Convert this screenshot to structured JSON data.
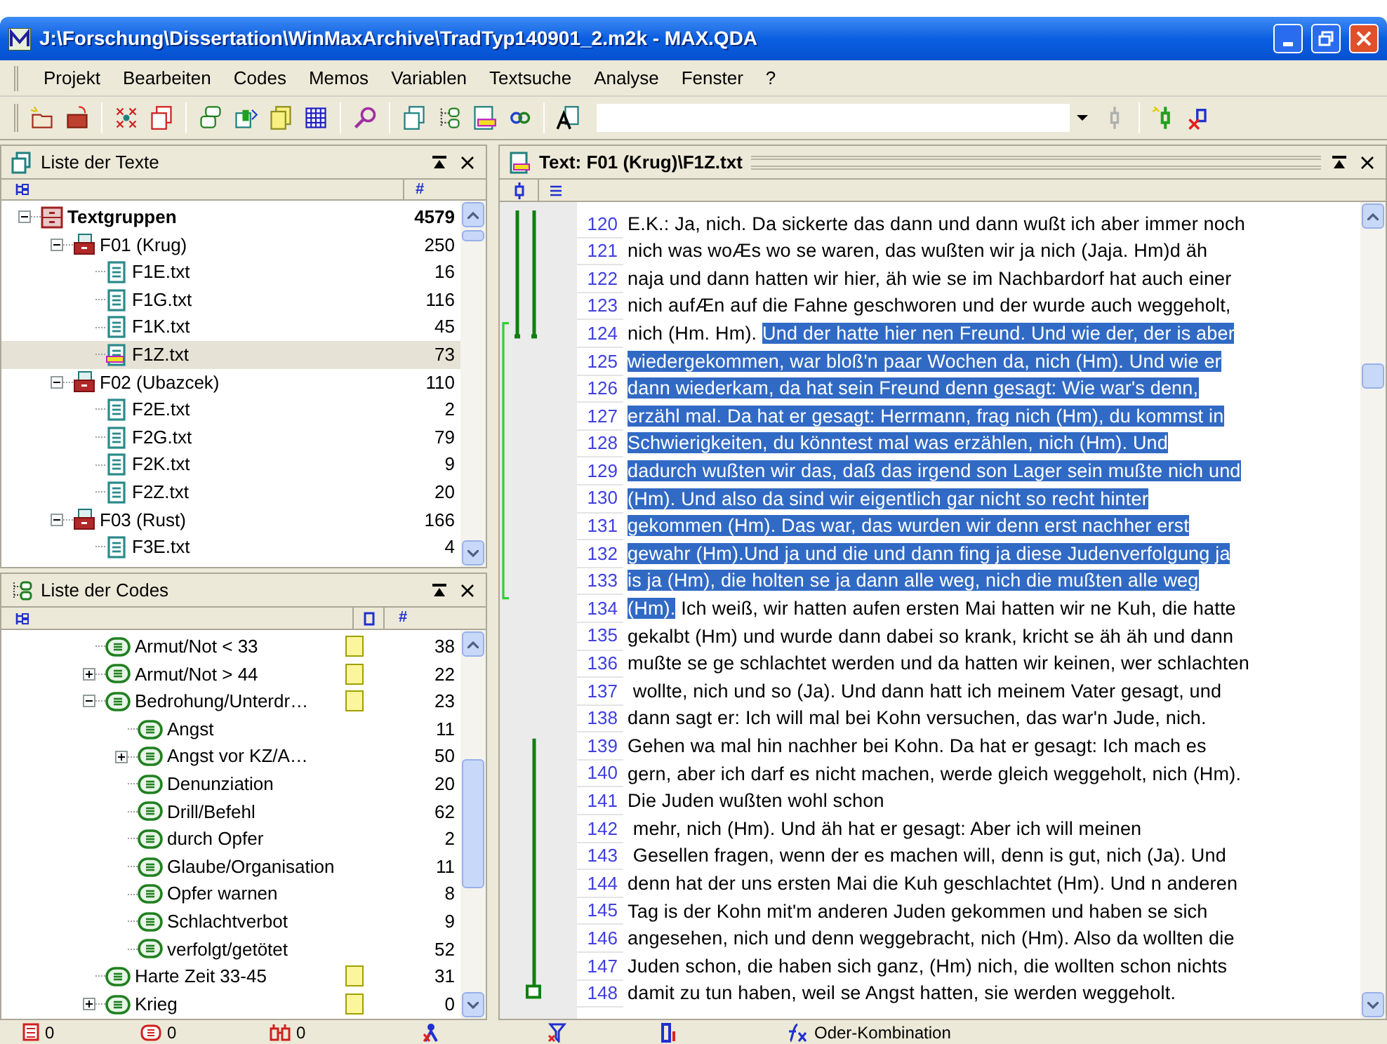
{
  "window": {
    "title": "J:\\Forschung\\Dissertation\\WinMaxArchive\\TradTyp140901_2.m2k - MAX.QDA"
  },
  "menu": [
    "Projekt",
    "Bearbeiten",
    "Codes",
    "Memos",
    "Variablen",
    "Textsuche",
    "Analyse",
    "Fenster",
    "?"
  ],
  "text_list": {
    "title": "Liste der Texte",
    "count_header": "#",
    "tree": [
      {
        "label": "Textgruppen",
        "count": "4579",
        "kind": "group",
        "expanded": true,
        "selected": false,
        "children": [
          {
            "label": "F01 (Krug)",
            "count": "250",
            "kind": "folder",
            "expanded": true,
            "selected": false,
            "children": [
              {
                "label": "F1E.txt",
                "count": "16",
                "kind": "file",
                "selected": false
              },
              {
                "label": "F1G.txt",
                "count": "116",
                "kind": "file",
                "selected": false
              },
              {
                "label": "F1K.txt",
                "count": "45",
                "kind": "file",
                "selected": false
              },
              {
                "label": "F1Z.txt",
                "count": "73",
                "kind": "file",
                "selected": true
              }
            ]
          },
          {
            "label": "F02 (Ubazcek)",
            "count": "110",
            "kind": "folder",
            "expanded": true,
            "selected": false,
            "children": [
              {
                "label": "F2E.txt",
                "count": "2",
                "kind": "file",
                "selected": false
              },
              {
                "label": "F2G.txt",
                "count": "79",
                "kind": "file",
                "selected": false
              },
              {
                "label": "F2K.txt",
                "count": "9",
                "kind": "file",
                "selected": false
              },
              {
                "label": "F2Z.txt",
                "count": "20",
                "kind": "file",
                "selected": false
              }
            ]
          },
          {
            "label": "F03 (Rust)",
            "count": "166",
            "kind": "folder",
            "expanded": true,
            "selected": false,
            "children": [
              {
                "label": "F3E.txt",
                "count": "4",
                "kind": "file",
                "selected": false
              }
            ]
          }
        ]
      }
    ]
  },
  "code_list": {
    "title": "Liste der Codes",
    "count_header": "#",
    "tree": [
      {
        "label": "Armut/Not < 33",
        "count": "38",
        "color": "#fbf59b"
      },
      {
        "label": "Armut/Not > 44",
        "count": "22",
        "color": "#fbf59b",
        "expanded": false
      },
      {
        "label": "Bedrohung/Unterdr…",
        "count": "23",
        "color": "#fbf59b",
        "expanded": true,
        "children": [
          {
            "label": "Angst",
            "count": "11"
          },
          {
            "label": "Angst vor KZ/A…",
            "count": "50",
            "expanded": false
          },
          {
            "label": "Denunziation",
            "count": "20"
          },
          {
            "label": "Drill/Befehl",
            "count": "62"
          },
          {
            "label": "durch Opfer",
            "count": "2"
          },
          {
            "label": "Glaube/Organisation",
            "count": "11"
          },
          {
            "label": "Opfer warnen",
            "count": "8"
          },
          {
            "label": "Schlachtverbot",
            "count": "9"
          },
          {
            "label": "verfolgt/getötet",
            "count": "52"
          }
        ]
      },
      {
        "label": "Harte Zeit 33-45",
        "count": "31",
        "color": "#fbf59b"
      },
      {
        "label": "Krieg",
        "count": "0",
        "color": "#fbf59b",
        "expanded": false
      }
    ]
  },
  "document": {
    "title": "Text: F01 (Krug)\\F1Z.txt",
    "lines": [
      {
        "number": "120",
        "parts": [
          {
            "text": "E.K.: Ja, nich. Da sickerte das dann und dann wußt ich aber immer noch",
            "selected": false
          }
        ]
      },
      {
        "number": "121",
        "parts": [
          {
            "text": "nich was woÆs wo se waren, das wußten wir ja nich (Jaja. Hm)d äh",
            "selected": false
          }
        ]
      },
      {
        "number": "122",
        "parts": [
          {
            "text": "naja und dann hatten wir hier, äh wie se im Nachbardorf hat auch einer",
            "selected": false
          }
        ]
      },
      {
        "number": "123",
        "parts": [
          {
            "text": "nich aufÆn auf die Fahne geschworen und der wurde auch weggeholt,",
            "selected": false
          }
        ]
      },
      {
        "number": "124",
        "parts": [
          {
            "text": "nich (Hm. Hm). ",
            "selected": false
          },
          {
            "text": "Und der hatte hier nen Freund. Und wie der, der is aber",
            "selected": true
          }
        ]
      },
      {
        "number": "125",
        "parts": [
          {
            "text": "wiedergekommen, war bloß'n paar Wochen da, nich (Hm). Und wie er",
            "selected": true
          }
        ]
      },
      {
        "number": "126",
        "parts": [
          {
            "text": "dann wiederkam, da hat sein Freund denn gesagt: Wie war's denn,",
            "selected": true
          }
        ]
      },
      {
        "number": "127",
        "parts": [
          {
            "text": "erzähl mal. Da hat er gesagt: Herrmann, frag nich (Hm), du kommst in",
            "selected": true
          }
        ]
      },
      {
        "number": "128",
        "parts": [
          {
            "text": "Schwierigkeiten, du könntest mal was erzählen, nich (Hm). Und",
            "selected": true
          }
        ]
      },
      {
        "number": "129",
        "parts": [
          {
            "text": "dadurch wußten wir das, daß das irgend son Lager sein mußte nich und",
            "selected": true
          }
        ]
      },
      {
        "number": "130",
        "parts": [
          {
            "text": "(Hm). Und also da sind wir eigentlich gar nicht so recht hinter",
            "selected": true
          }
        ]
      },
      {
        "number": "131",
        "parts": [
          {
            "text": "gekommen (Hm). Das war, das wurden wir denn erst nachher erst",
            "selected": true
          }
        ]
      },
      {
        "number": "132",
        "parts": [
          {
            "text": "gewahr (Hm).Und ja und die und dann fing ja diese Judenverfolgung ja",
            "selected": true
          }
        ]
      },
      {
        "number": "133",
        "parts": [
          {
            "text": "is ja (Hm), die holten se ja dann alle weg, nich die mußten alle weg",
            "selected": true
          }
        ]
      },
      {
        "number": "134",
        "parts": [
          {
            "text": "(Hm).",
            "selected": true
          },
          {
            "text": " Ich weiß, wir hatten aufen ersten Mai hatten wir ne Kuh, die hatte",
            "selected": false
          }
        ]
      },
      {
        "number": "135",
        "parts": [
          {
            "text": "gekalbt (Hm) und wurde dann dabei so krank, kricht se äh äh und dann",
            "selected": false
          }
        ]
      },
      {
        "number": "136",
        "parts": [
          {
            "text": "mußte se ge schlachtet werden und da hatten wir keinen, wer schlachten",
            "selected": false
          }
        ]
      },
      {
        "number": "137",
        "parts": [
          {
            "text": " wollte, nich und so (Ja). Und dann hatt ich meinem Vater gesagt, und",
            "selected": false
          }
        ]
      },
      {
        "number": "138",
        "parts": [
          {
            "text": "dann sagt er: Ich will mal bei Kohn versuchen, das war'n Jude, nich.",
            "selected": false
          }
        ]
      },
      {
        "number": "139",
        "parts": [
          {
            "text": "Gehen wa mal hin nachher bei Kohn. Da hat er gesagt: Ich mach es",
            "selected": false
          }
        ]
      },
      {
        "number": "140",
        "parts": [
          {
            "text": "gern, aber ich darf es nicht machen, werde gleich weggeholt, nich (Hm).",
            "selected": false
          }
        ]
      },
      {
        "number": "141",
        "parts": [
          {
            "text": "Die Juden wußten wohl schon",
            "selected": false
          }
        ]
      },
      {
        "number": "142",
        "parts": [
          {
            "text": " mehr, nich (Hm). Und äh hat er gesagt: Aber ich will meinen",
            "selected": false
          }
        ]
      },
      {
        "number": "143",
        "parts": [
          {
            "text": " Gesellen fragen, wenn der es machen will, denn is gut, nich (Ja). Und",
            "selected": false
          }
        ]
      },
      {
        "number": "144",
        "parts": [
          {
            "text": "denn hat der uns ersten Mai die Kuh geschlachtet (Hm). Und n anderen",
            "selected": false
          }
        ]
      },
      {
        "number": "145",
        "parts": [
          {
            "text": "Tag is der Kohn mit'm anderen Juden gekommen und haben se sich",
            "selected": false
          }
        ]
      },
      {
        "number": "146",
        "parts": [
          {
            "text": "angesehen, nich und denn weggebracht, nich (Hm). Also da wollten die",
            "selected": false
          }
        ]
      },
      {
        "number": "147",
        "parts": [
          {
            "text": "Juden schon, die haben sich ganz, (Hm) nich, die wollten schon nichts",
            "selected": false
          }
        ]
      },
      {
        "number": "148",
        "parts": [
          {
            "text": "damit zu tun haben, weil se Angst hatten, sie werden weggeholt.",
            "selected": false
          }
        ]
      }
    ]
  },
  "status_bar": {
    "counts": [
      "0",
      "0",
      "0"
    ],
    "combination": "Oder-Kombination"
  }
}
